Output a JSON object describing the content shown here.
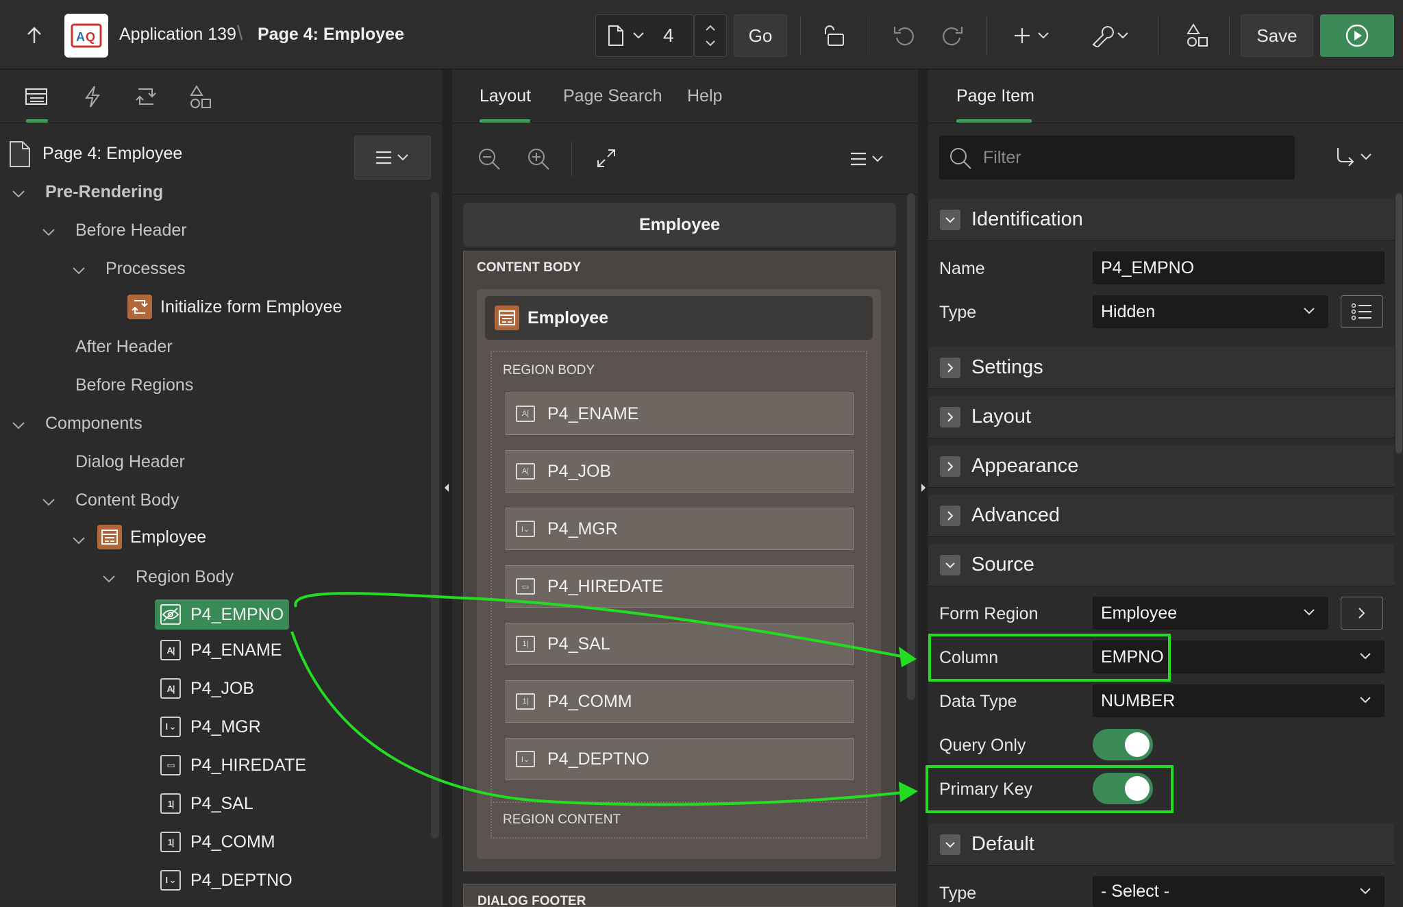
{
  "header": {
    "app_name": "Application 139",
    "separator": "\\",
    "page_title": "Page 4: Employee",
    "page_number": "4",
    "go_label": "Go",
    "save_label": "Save"
  },
  "left_tabs": [
    "rendering",
    "dynamic-actions",
    "processing",
    "shared-components"
  ],
  "tree": {
    "root": "Page 4: Employee",
    "pre_rendering": "Pre-Rendering",
    "before_header": "Before Header",
    "processes": "Processes",
    "init_process": "Initialize form Employee",
    "after_header": "After Header",
    "before_regions": "Before Regions",
    "components": "Components",
    "dialog_header": "Dialog Header",
    "content_body": "Content Body",
    "region": "Employee",
    "region_body": "Region Body",
    "items": [
      {
        "label": "P4_EMPNO",
        "icon": "hidden-item-icon"
      },
      {
        "label": "P4_ENAME",
        "icon": "text-field-icon"
      },
      {
        "label": "P4_JOB",
        "icon": "text-field-icon"
      },
      {
        "label": "P4_MGR",
        "icon": "select-list-icon"
      },
      {
        "label": "P4_HIREDATE",
        "icon": "calendar-icon"
      },
      {
        "label": "P4_SAL",
        "icon": "number-field-icon"
      },
      {
        "label": "P4_COMM",
        "icon": "number-field-icon"
      },
      {
        "label": "P4_DEPTNO",
        "icon": "select-list-icon"
      }
    ]
  },
  "middle": {
    "tabs": [
      "Layout",
      "Page Search",
      "Help"
    ],
    "page_header": "Employee",
    "content_body_label": "CONTENT BODY",
    "region_title": "Employee",
    "region_body_label": "REGION BODY",
    "items": [
      {
        "label": "P4_ENAME",
        "icon": "text-field-icon"
      },
      {
        "label": "P4_JOB",
        "icon": "text-field-icon"
      },
      {
        "label": "P4_MGR",
        "icon": "select-list-icon"
      },
      {
        "label": "P4_HIREDATE",
        "icon": "calendar-icon"
      },
      {
        "label": "P4_SAL",
        "icon": "number-field-icon"
      },
      {
        "label": "P4_COMM",
        "icon": "number-field-icon"
      },
      {
        "label": "P4_DEPTNO",
        "icon": "select-list-icon"
      }
    ],
    "region_content_label": "REGION CONTENT",
    "dialog_footer_label": "DIALOG FOOTER"
  },
  "right": {
    "tab": "Page Item",
    "filter_placeholder": "Filter",
    "sections": {
      "identification": "Identification",
      "settings": "Settings",
      "layout": "Layout",
      "appearance": "Appearance",
      "advanced": "Advanced",
      "source": "Source",
      "default": "Default"
    },
    "props": {
      "name_label": "Name",
      "name_value": "P4_EMPNO",
      "type_label": "Type",
      "type_value": "Hidden",
      "form_region_label": "Form Region",
      "form_region_value": "Employee",
      "column_label": "Column",
      "column_value": "EMPNO",
      "data_type_label": "Data Type",
      "data_type_value": "NUMBER",
      "query_only_label": "Query Only",
      "query_only_value": true,
      "primary_key_label": "Primary Key",
      "primary_key_value": true,
      "default_type_label": "Type",
      "default_type_value": "- Select -"
    }
  },
  "colors": {
    "accent": "#3f9a5c",
    "highlight": "#22dd22",
    "orange": "#b0683a"
  }
}
